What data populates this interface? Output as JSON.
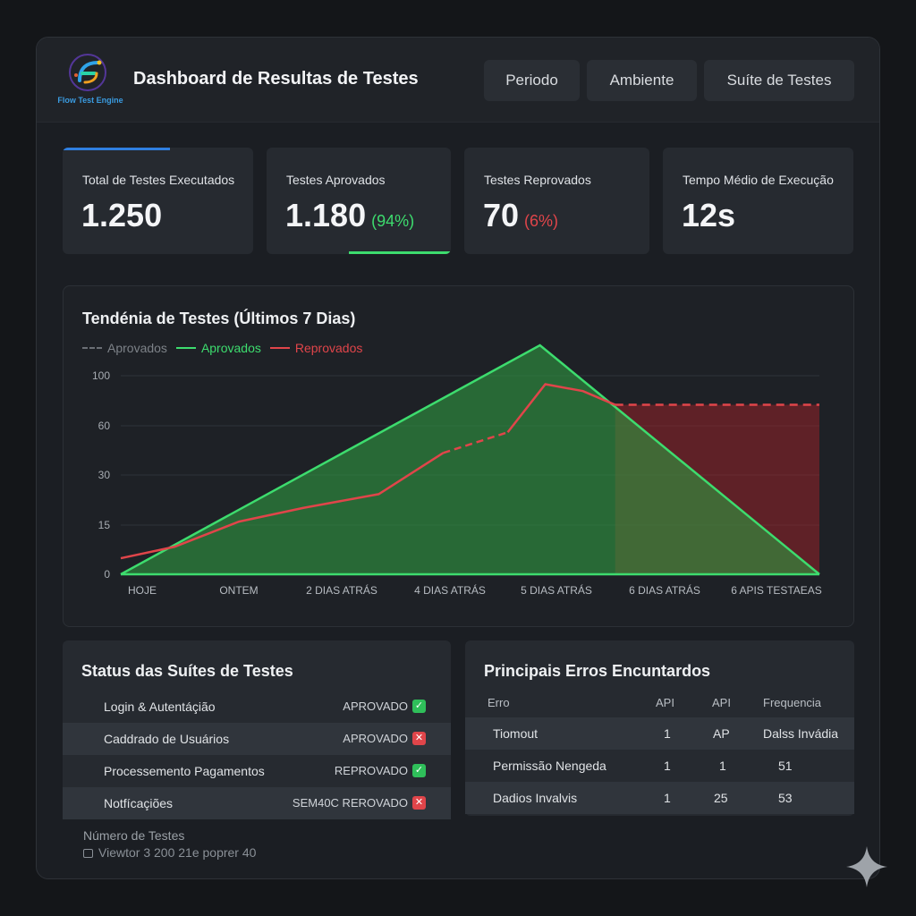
{
  "header": {
    "logo_text": "Flow Test Engine",
    "title": "Dashboard de Resultas de Testes",
    "buttons": [
      "Periodo",
      "Ambiente",
      "Suíte de Testes"
    ]
  },
  "kpis": [
    {
      "label": "Total de Testes Executados",
      "value": "1.250",
      "pct": ""
    },
    {
      "label": "Testes Aprovados",
      "value": "1.180",
      "pct": "(94%)"
    },
    {
      "label": "Testes Reprovados",
      "value": "70",
      "pct": "(6%)"
    },
    {
      "label": "Tempo Médio de Execução",
      "value": "12s",
      "pct": ""
    }
  ],
  "colors": {
    "accent_blue": "#2f7fe0",
    "pass_green": "#3ddc6e",
    "fail_red": "#e0454a"
  },
  "chart_data": {
    "type": "area",
    "title": "Tendénia de Testes (Últimos 7 Dias)",
    "legend": [
      {
        "label": "Aprovados",
        "style": "dashed",
        "color": "#6b6f75"
      },
      {
        "label": "Aprovados",
        "style": "solid",
        "color": "#3ddc6e"
      },
      {
        "label": "Reprovados",
        "style": "solid",
        "color": "#e0454a"
      }
    ],
    "categories": [
      "HOJE",
      "ONTEM",
      "2 DIAS ATRÁS",
      "4 DIAS ATRÁS",
      "5 DIAS ATRÁS",
      "6 DIAS ATRÁS",
      "6 APIS TESTAEAS"
    ],
    "y_ticks": [
      "0",
      "15",
      "30",
      "60",
      "100"
    ],
    "series": [
      {
        "name": "Aprovados",
        "x": [
          0,
          3.9,
          6.5
        ],
        "values": [
          0,
          100,
          0
        ]
      },
      {
        "name": "Reprovados",
        "x": [
          0,
          0.5,
          1.1,
          1.7,
          2.4,
          3.0,
          3.6,
          3.95,
          4.3,
          4.6,
          6.5
        ],
        "values": [
          7,
          12,
          23,
          29,
          35,
          53,
          62,
          83,
          80,
          74,
          74
        ]
      }
    ],
    "ylim": [
      0,
      100
    ],
    "grid": true,
    "legend_position": "top-left"
  },
  "suites": {
    "title": "Status das Suítes de Testes",
    "rows": [
      {
        "name": "Login & Autentáçião",
        "status": "APROVADO",
        "icon": "check-icon"
      },
      {
        "name": "Caddrado de Usuários",
        "status": "APROVADO",
        "icon": "x-icon"
      },
      {
        "name": "Processemento Pagamentos",
        "status": "REPROVADO",
        "icon": "check-icon"
      },
      {
        "name": "Notfícaçiões",
        "status": "SEM40C REROVADO",
        "icon": "x-icon"
      }
    ]
  },
  "errors": {
    "title": "Principais Erros Encuntardos",
    "headers": [
      "Erro",
      "API",
      "API",
      "Frequencia"
    ],
    "rows": [
      [
        "Tiomout",
        "1",
        "AP",
        "Dalss Invádia"
      ],
      [
        "Permissão Nengeda",
        "1",
        "1",
        "51"
      ],
      [
        "Dadios Invalvis",
        "1",
        "25",
        "53"
      ]
    ]
  },
  "footer": {
    "line1": "Número de Testes",
    "line2": "Viewtor 3 200 21e poprer 40"
  }
}
